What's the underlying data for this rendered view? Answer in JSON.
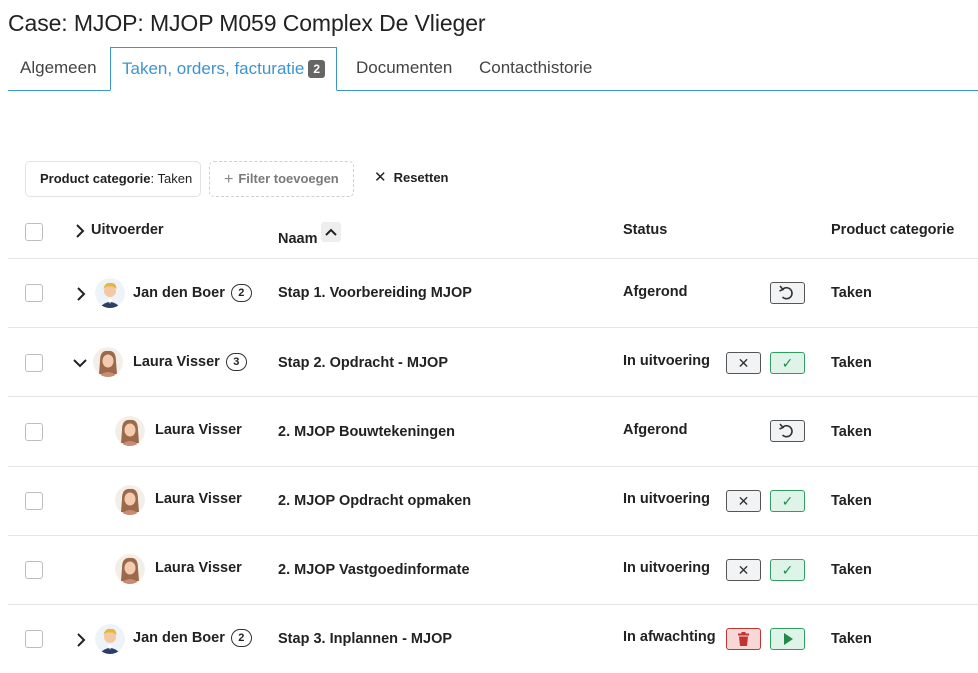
{
  "title": "Case: MJOP: MJOP M059 Complex De Vlieger",
  "tabs": [
    {
      "label": "Algemeen"
    },
    {
      "label": "Taken, orders, facturatie",
      "badge": "2"
    },
    {
      "label": "Documenten"
    },
    {
      "label": "Contacthistorie"
    }
  ],
  "filters": {
    "category_key": "Product categorie",
    "category_value": "Taken",
    "add_label": "Filter toevoegen",
    "reset_label": "Resetten"
  },
  "columns": {
    "uitvoerder": "Uitvoerder",
    "naam": "Naam",
    "status": "Status",
    "category": "Product categorie"
  },
  "rows": [
    {
      "person": "Jan den Boer",
      "count": "2",
      "name": "Stap 1. Voorbereiding MJOP",
      "status": "Afgerond",
      "category": "Taken",
      "expand": "collapsed",
      "actions": [
        "undo"
      ]
    },
    {
      "person": "Laura Visser",
      "count": "3",
      "name": "Stap 2. Opdracht - MJOP",
      "status": "In uitvoering",
      "category": "Taken",
      "expand": "expanded",
      "actions": [
        "cancel",
        "complete"
      ]
    },
    {
      "person": "Laura Visser",
      "name": "2. MJOP Bouwtekeningen",
      "status": "Afgerond",
      "category": "Taken",
      "child": true,
      "actions": [
        "undo"
      ]
    },
    {
      "person": "Laura Visser",
      "name": "2. MJOP Opdracht opmaken",
      "status": "In uitvoering",
      "category": "Taken",
      "child": true,
      "actions": [
        "cancel",
        "complete"
      ]
    },
    {
      "person": "Laura Visser",
      "name": "2. MJOP Vastgoedinformate",
      "status": "In uitvoering",
      "category": "Taken",
      "child": true,
      "actions": [
        "cancel",
        "complete"
      ]
    },
    {
      "person": "Jan den Boer",
      "count": "2",
      "name": "Stap 3. Inplannen - MJOP",
      "status": "In afwachting",
      "category": "Taken",
      "expand": "collapsed",
      "actions": [
        "delete",
        "start"
      ]
    }
  ],
  "icons": {
    "sort": "sort-ascending-icon",
    "expand": "chevron-right-icon",
    "collapse": "chevron-down-icon",
    "undo": "undo-icon",
    "cancel": "close-icon",
    "complete": "check-icon",
    "delete": "trash-icon",
    "start": "play-icon"
  },
  "colors": {
    "accent": "#3d95cf",
    "success": "#2f9e5e",
    "danger": "#c03434"
  }
}
